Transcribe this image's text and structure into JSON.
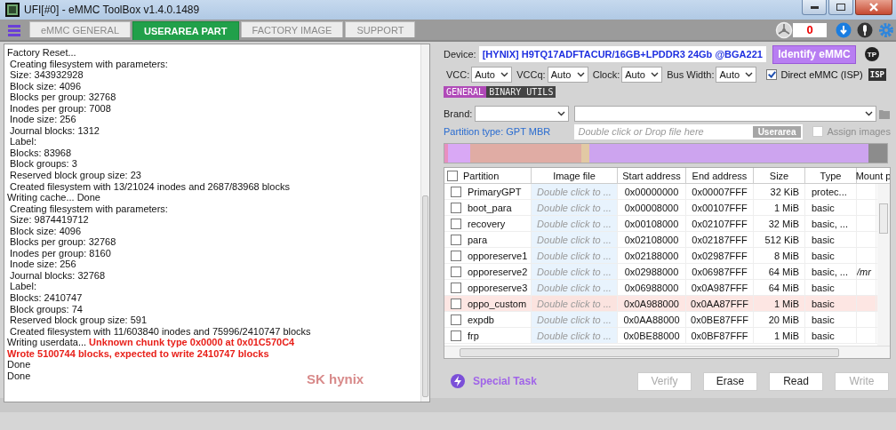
{
  "window": {
    "title": "UFI[#0] - eMMC ToolBox v1.4.0.1489"
  },
  "tabs": [
    {
      "label": "eMMC GENERAL",
      "selected": false
    },
    {
      "label": "USERAREA PART",
      "selected": true
    },
    {
      "label": "FACTORY IMAGE",
      "selected": false
    },
    {
      "label": "SUPPORT",
      "selected": false
    }
  ],
  "counter": "0",
  "log": {
    "lines": [
      {
        "indented": false,
        "parts": [
          {
            "kind": "normal",
            "text": "Factory Reset..."
          }
        ]
      },
      {
        "indented": true,
        "parts": [
          {
            "kind": "normal",
            "text": "Creating filesystem with parameters:"
          }
        ]
      },
      {
        "indented": true,
        "parts": [
          {
            "kind": "normal",
            "text": "Size: 343932928"
          }
        ]
      },
      {
        "indented": true,
        "parts": [
          {
            "kind": "normal",
            "text": "Block size: 4096"
          }
        ]
      },
      {
        "indented": true,
        "parts": [
          {
            "kind": "normal",
            "text": "Blocks per group: 32768"
          }
        ]
      },
      {
        "indented": true,
        "parts": [
          {
            "kind": "normal",
            "text": "Inodes per group: 7008"
          }
        ]
      },
      {
        "indented": true,
        "parts": [
          {
            "kind": "normal",
            "text": "Inode size: 256"
          }
        ]
      },
      {
        "indented": true,
        "parts": [
          {
            "kind": "normal",
            "text": "Journal blocks: 1312"
          }
        ]
      },
      {
        "indented": true,
        "parts": [
          {
            "kind": "normal",
            "text": "Label:"
          }
        ]
      },
      {
        "indented": true,
        "parts": [
          {
            "kind": "normal",
            "text": "Blocks: 83968"
          }
        ]
      },
      {
        "indented": true,
        "parts": [
          {
            "kind": "normal",
            "text": "Block groups: 3"
          }
        ]
      },
      {
        "indented": true,
        "parts": [
          {
            "kind": "normal",
            "text": "Reserved block group size: 23"
          }
        ]
      },
      {
        "indented": true,
        "parts": [
          {
            "kind": "normal",
            "text": "Created filesystem with 13/21024 inodes and 2687/83968 blocks"
          }
        ]
      },
      {
        "indented": false,
        "parts": [
          {
            "kind": "normal",
            "text": "Writing cache... Done"
          }
        ]
      },
      {
        "indented": true,
        "parts": [
          {
            "kind": "normal",
            "text": "Creating filesystem with parameters:"
          }
        ]
      },
      {
        "indented": true,
        "parts": [
          {
            "kind": "normal",
            "text": "Size: 9874419712"
          }
        ]
      },
      {
        "indented": true,
        "parts": [
          {
            "kind": "normal",
            "text": "Block size: 4096"
          }
        ]
      },
      {
        "indented": true,
        "parts": [
          {
            "kind": "normal",
            "text": "Blocks per group: 32768"
          }
        ]
      },
      {
        "indented": true,
        "parts": [
          {
            "kind": "normal",
            "text": "Inodes per group: 8160"
          }
        ]
      },
      {
        "indented": true,
        "parts": [
          {
            "kind": "normal",
            "text": "Inode size: 256"
          }
        ]
      },
      {
        "indented": true,
        "parts": [
          {
            "kind": "normal",
            "text": "Journal blocks: 32768"
          }
        ]
      },
      {
        "indented": true,
        "parts": [
          {
            "kind": "normal",
            "text": "Label:"
          }
        ]
      },
      {
        "indented": true,
        "parts": [
          {
            "kind": "normal",
            "text": "Blocks: 2410747"
          }
        ]
      },
      {
        "indented": true,
        "parts": [
          {
            "kind": "normal",
            "text": "Block groups: 74"
          }
        ]
      },
      {
        "indented": true,
        "parts": [
          {
            "kind": "normal",
            "text": "Reserved block group size: 591"
          }
        ]
      },
      {
        "indented": true,
        "parts": [
          {
            "kind": "normal",
            "text": "Created filesystem with 11/603840 inodes and 75996/2410747 blocks"
          }
        ]
      },
      {
        "indented": false,
        "parts": [
          {
            "kind": "normal",
            "text": "Writing userdata..."
          },
          {
            "kind": "error",
            "text": "Unknown chunk type 0x0000 at 0x01C570C4"
          }
        ]
      },
      {
        "indented": false,
        "parts": [
          {
            "kind": "error",
            "text": "Wrote 5100744 blocks, expected to write 2410747 blocks"
          }
        ]
      },
      {
        "indented": false,
        "parts": [
          {
            "kind": "normal",
            "text": "Done"
          }
        ]
      },
      {
        "indented": false,
        "parts": [
          {
            "kind": "normal",
            "text": "Done"
          }
        ]
      }
    ],
    "logo_text": "SK hynix"
  },
  "device": {
    "label": "Device:",
    "value": "[HYNIX] H9TQ17ADFTACUR/16GB+LPDDR3 24Gb  @BGA221",
    "identify_button": "Identify eMMC",
    "tp_badge": "TP"
  },
  "selects": [
    {
      "label": "VCC:",
      "value": "Auto"
    },
    {
      "label": "VCCq:",
      "value": "Auto"
    },
    {
      "label": "Clock:",
      "value": "Auto"
    },
    {
      "label": "Bus Width:",
      "value": "Auto"
    }
  ],
  "direct_emmc": {
    "label": "Direct eMMC (ISP)",
    "checked": true,
    "badge": "ISP"
  },
  "subtabs": [
    {
      "label": "GENERAL",
      "selected": true
    },
    {
      "label": "BINARY UTILS",
      "selected": false
    }
  ],
  "brand": {
    "label": "Brand:"
  },
  "partition_type": "Partition type: GPT MBR",
  "file_field": {
    "placeholder": "Double click or Drop file here",
    "tag": "Userarea"
  },
  "assign_images": {
    "label": "Assign images",
    "checked": false,
    "disabled": true
  },
  "partition_map": [
    {
      "color": "#e88fc0"
    },
    {
      "color": "#d9a8f5"
    },
    {
      "color": "#e0aca4"
    },
    {
      "color": "#e2c9a4"
    },
    {
      "color": "#cda4ef"
    },
    {
      "color": "#8c8c8c"
    }
  ],
  "table": {
    "columns": [
      "Partition",
      "Image file",
      "Start address",
      "End address",
      "Size",
      "Type",
      "Mount p"
    ],
    "rows": [
      {
        "checked": false,
        "highlighted": false,
        "cells": [
          "PrimaryGPT",
          "Double click to ...",
          "0x00000000",
          "0x00007FFF",
          "32 KiB",
          "protec...",
          ""
        ]
      },
      {
        "checked": false,
        "highlighted": false,
        "cells": [
          "boot_para",
          "Double click to ...",
          "0x00008000",
          "0x00107FFF",
          "1 MiB",
          "basic",
          ""
        ]
      },
      {
        "checked": false,
        "highlighted": false,
        "cells": [
          "recovery",
          "Double click to ...",
          "0x00108000",
          "0x02107FFF",
          "32 MiB",
          "basic, ...",
          ""
        ]
      },
      {
        "checked": false,
        "highlighted": false,
        "cells": [
          "para",
          "Double click to ...",
          "0x02108000",
          "0x02187FFF",
          "512 KiB",
          "basic",
          ""
        ]
      },
      {
        "checked": false,
        "highlighted": false,
        "cells": [
          "opporeserve1",
          "Double click to ...",
          "0x02188000",
          "0x02987FFF",
          "8 MiB",
          "basic",
          ""
        ]
      },
      {
        "checked": false,
        "highlighted": false,
        "cells": [
          "opporeserve2",
          "Double click to ...",
          "0x02988000",
          "0x06987FFF",
          "64 MiB",
          "basic, ...",
          "/mr"
        ]
      },
      {
        "checked": false,
        "highlighted": false,
        "cells": [
          "opporeserve3",
          "Double click to ...",
          "0x06988000",
          "0x0A987FFF",
          "64 MiB",
          "basic",
          ""
        ]
      },
      {
        "checked": false,
        "highlighted": true,
        "cells": [
          "oppo_custom",
          "Double click to ...",
          "0x0A988000",
          "0x0AA87FFF",
          "1 MiB",
          "basic",
          ""
        ]
      },
      {
        "checked": false,
        "highlighted": false,
        "cells": [
          "expdb",
          "Double click to ...",
          "0x0AA88000",
          "0x0BE87FFF",
          "20 MiB",
          "basic",
          ""
        ]
      },
      {
        "checked": false,
        "highlighted": false,
        "cells": [
          "frp",
          "Double click to ...",
          "0x0BE88000",
          "0x0BF87FFF",
          "1 MiB",
          "basic",
          ""
        ]
      }
    ]
  },
  "special_task": "Special Task",
  "actions": [
    {
      "label": "Verify",
      "disabled": true
    },
    {
      "label": "Erase",
      "disabled": false
    },
    {
      "label": "Read",
      "disabled": false
    },
    {
      "label": "Write",
      "disabled": true
    }
  ]
}
